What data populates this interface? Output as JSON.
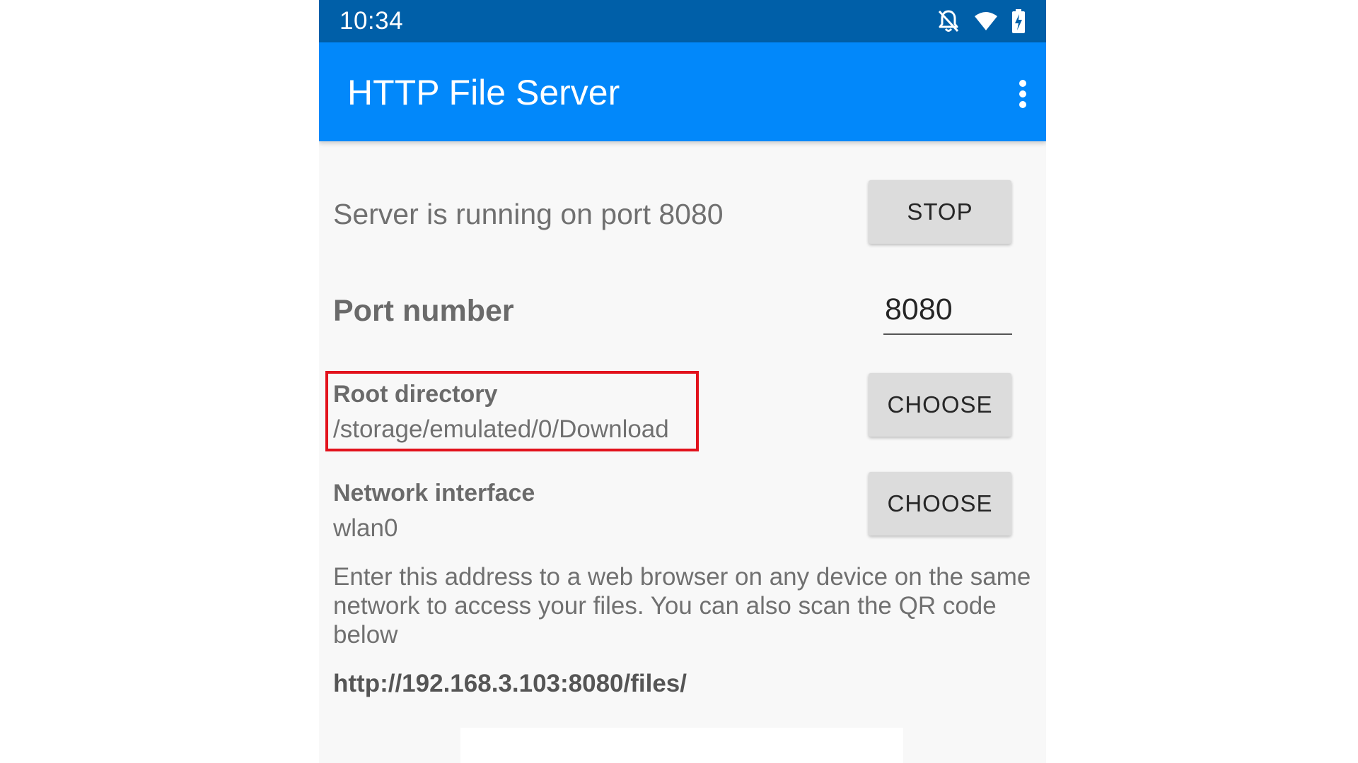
{
  "status_bar": {
    "time": "10:34",
    "icons": [
      "notifications-off-icon",
      "wifi-icon",
      "battery-charging-icon"
    ]
  },
  "app_bar": {
    "title": "HTTP File Server",
    "overflow_icon": "more-vert-icon"
  },
  "server": {
    "status_text": "Server is running on port 8080",
    "stop_label": "STOP"
  },
  "port": {
    "label": "Port number",
    "value": "8080"
  },
  "root_directory": {
    "title": "Root directory",
    "value": "/storage/emulated/0/Download",
    "choose_label": "CHOOSE"
  },
  "network_interface": {
    "title": "Network interface",
    "value": "wlan0",
    "choose_label": "CHOOSE"
  },
  "help_text": "Enter this address to a web browser on any device on the same network to access your files. You can also scan the QR code below",
  "address": "http://192.168.3.103:8080/files/",
  "colors": {
    "status_bar": "#005fa8",
    "app_bar": "#0288fa",
    "background": "#f8f8f8",
    "button": "#dcdcdc",
    "highlight": "#e2121c"
  }
}
